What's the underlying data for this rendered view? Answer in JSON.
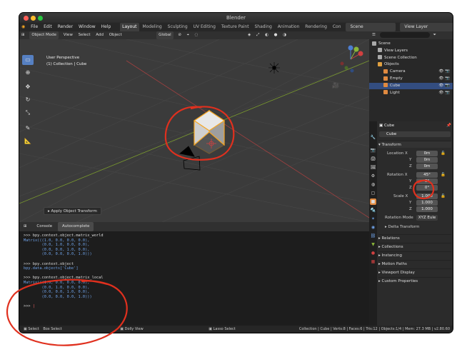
{
  "window": {
    "title": "Blender"
  },
  "menu": {
    "items": [
      "File",
      "Edit",
      "Render",
      "Window",
      "Help"
    ],
    "workspaces": [
      "Layout",
      "Modeling",
      "Sculpting",
      "UV Editing",
      "Texture Paint",
      "Shading",
      "Animation",
      "Rendering",
      "Con"
    ],
    "active_workspace": "Layout",
    "scene": "Scene",
    "view_layer": "View Layer"
  },
  "viewport_header": {
    "mode": "Object Mode",
    "view": "View",
    "select": "Select",
    "add": "Add",
    "object": "Object",
    "orientation": "Global"
  },
  "viewport": {
    "perspective": "User Perspective",
    "collection": "(1) Collection | Cube",
    "last_op": "Apply Object Transform"
  },
  "console": {
    "tabs": [
      "Console",
      "Autocomplete"
    ],
    "active_tab": "Autocomplete",
    "lines": [
      {
        "t": ">>> bpy.context.object.matrix_world",
        "k": "in"
      },
      {
        "t": "Matrix(((1.0, 0.0, 0.0, 0.0),",
        "k": "out"
      },
      {
        "t": "        (0.0, 1.0, 0.0, 0.0),",
        "k": "out"
      },
      {
        "t": "        (0.0, 0.0, 1.0, 0.0),",
        "k": "out"
      },
      {
        "t": "        (0.0, 0.0, 0.0, 1.0)))",
        "k": "out"
      },
      {
        "t": "",
        "k": "in"
      },
      {
        "t": ">>> bpy.context.object",
        "k": "in"
      },
      {
        "t": "bpy.data.objects['Cube']",
        "k": "out"
      },
      {
        "t": "",
        "k": "in"
      },
      {
        "t": ">>> bpy.context.object.matrix_local",
        "k": "in"
      },
      {
        "t": "Matrix(((1.0, 0.0, 0.0, 0.0),",
        "k": "out"
      },
      {
        "t": "        (0.0, 1.0, 0.0, 0.0),",
        "k": "out"
      },
      {
        "t": "        (0.0, 0.0, 1.0, 0.0),",
        "k": "out"
      },
      {
        "t": "        (0.0, 0.0, 0.0, 1.0)))",
        "k": "out"
      },
      {
        "t": "",
        "k": "in"
      },
      {
        "t": ">>> ",
        "k": "in"
      }
    ]
  },
  "status": {
    "left": [
      "Select",
      "Box Select",
      "Dolly View",
      "Lasso Select"
    ],
    "right": "Collection | Cube | Verts:8 | Faces:6 | Tris:12 | Objects:1/4 | Mem: 27.3 MB | v2.80.60"
  },
  "outliner": {
    "rows": [
      {
        "label": "Scene",
        "indent": 0,
        "color": "#aaaaaa"
      },
      {
        "label": "View Layers",
        "indent": 1,
        "color": "#aaaaaa"
      },
      {
        "label": "Scene Collection",
        "indent": 1,
        "color": "#aaaaaa"
      },
      {
        "label": "Objects",
        "indent": 1,
        "color": "#e0a040"
      },
      {
        "label": "Camera",
        "indent": 2,
        "color": "#e08a40"
      },
      {
        "label": "Empty",
        "indent": 2,
        "color": "#e08a40"
      },
      {
        "label": "Cube",
        "indent": 2,
        "color": "#e08a40",
        "selected": true
      },
      {
        "label": "Light",
        "indent": 2,
        "color": "#e08a40"
      }
    ]
  },
  "properties": {
    "object_name": "Cube",
    "field_name": "Cube",
    "transform_label": "Transform",
    "location": {
      "x": "0m",
      "y": "0m",
      "z": "0m"
    },
    "rotation": {
      "x": "45°",
      "y": "0°",
      "z": "0°"
    },
    "scale": {
      "x": "1.000",
      "y": "1.000",
      "z": "1.000"
    },
    "labels": {
      "loc_x": "Location X",
      "rot_x": "Rotation X",
      "scale_x": "Scale X",
      "y": "Y",
      "z": "Z",
      "rot_mode": "Rotation Mode"
    },
    "rotation_mode": "XYZ Eule",
    "delta": "Delta Transform",
    "sections": [
      "Relations",
      "Collections",
      "Instancing",
      "Motion Paths",
      "Viewport Display",
      "Custom Properties"
    ]
  },
  "colors": {
    "accent": "#5680c2",
    "selected_row": "#334d80",
    "annotation": "#e0301e",
    "object_orange": "#f5a623"
  }
}
